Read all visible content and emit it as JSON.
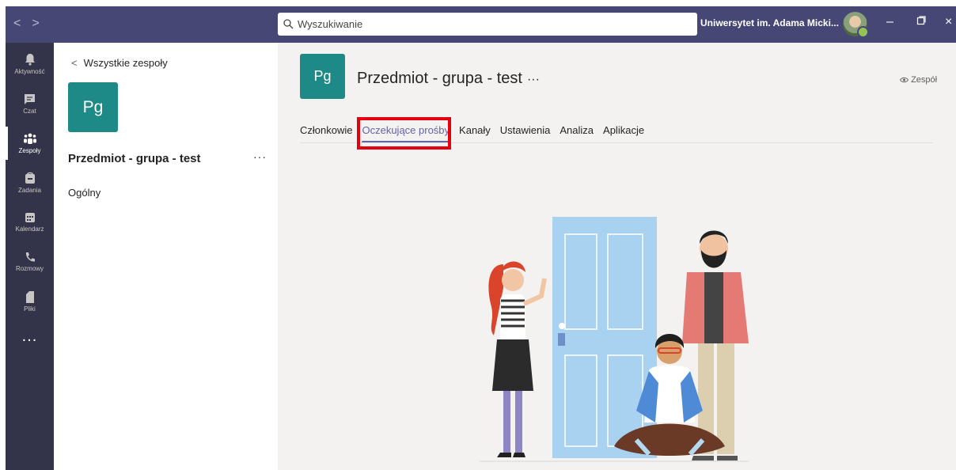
{
  "titlebar": {
    "search_placeholder": "Wyszukiwanie",
    "organization": "Uniwersytet im. Adama Micki...",
    "colors": {
      "bar": "#464775",
      "presence": "#92c353"
    }
  },
  "rail": {
    "items": [
      {
        "label": "Aktywność",
        "icon": "bell-icon"
      },
      {
        "label": "Czat",
        "icon": "chat-icon"
      },
      {
        "label": "Zespoły",
        "icon": "teams-icon",
        "active": true
      },
      {
        "label": "Zadania",
        "icon": "assignments-icon"
      },
      {
        "label": "Kalendarz",
        "icon": "calendar-icon"
      },
      {
        "label": "Rozmowy",
        "icon": "phone-icon"
      },
      {
        "label": "Pliki",
        "icon": "files-icon"
      }
    ],
    "more": "..."
  },
  "panel": {
    "back_label": "Wszystkie zespoły",
    "team_initials": "Pg",
    "team_name": "Przedmiot - grupa - test",
    "team_more": "···",
    "channel": "Ogólny"
  },
  "main": {
    "team_initials": "Pg",
    "title": "Przedmiot - grupa - test",
    "title_more": "···",
    "visibility": "Zespół",
    "tabs": [
      {
        "label": "Członkowie"
      },
      {
        "label": "Oczekujące prośby",
        "active": true
      },
      {
        "label": "Kanały"
      },
      {
        "label": "Ustawienia"
      },
      {
        "label": "Analiza"
      },
      {
        "label": "Aplikacje"
      }
    ],
    "accent_color": "#6264a7",
    "highlight_color": "#e3000f",
    "team_color": "#1d8a87"
  }
}
